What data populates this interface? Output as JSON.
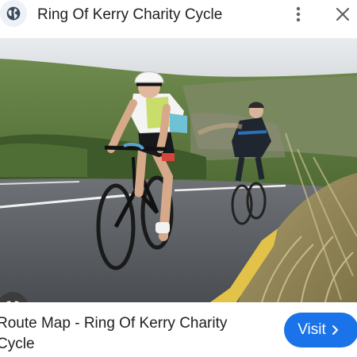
{
  "header": {
    "title": "Ring Of Kerry Charity Cycle",
    "globe_icon": "globe-icon",
    "menu_icon": "more-vert-icon",
    "close_icon": "close-icon"
  },
  "image": {
    "alt": "Cyclists on the Ring of Kerry road",
    "lens_icon": "google-lens-icon"
  },
  "result": {
    "caption": "Route Map - Ring Of Kerry Charity Cycle",
    "visit_label": "Visit",
    "visit_icon": "chevron-right-icon"
  },
  "colors": {
    "accent": "#1a73e8",
    "text": "#202124",
    "icon": "#5f6368"
  }
}
